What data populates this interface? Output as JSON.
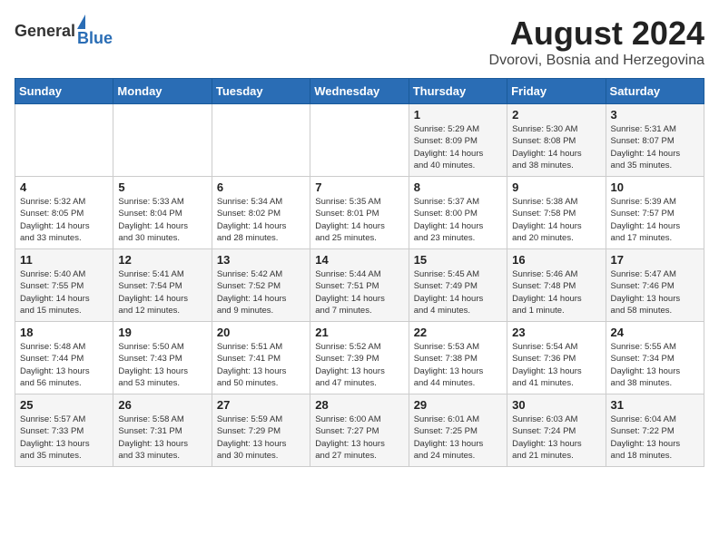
{
  "header": {
    "logo_general": "General",
    "logo_blue": "Blue",
    "month_year": "August 2024",
    "location": "Dvorovi, Bosnia and Herzegovina"
  },
  "weekdays": [
    "Sunday",
    "Monday",
    "Tuesday",
    "Wednesday",
    "Thursday",
    "Friday",
    "Saturday"
  ],
  "weeks": [
    [
      {
        "day": "",
        "info": ""
      },
      {
        "day": "",
        "info": ""
      },
      {
        "day": "",
        "info": ""
      },
      {
        "day": "",
        "info": ""
      },
      {
        "day": "1",
        "info": "Sunrise: 5:29 AM\nSunset: 8:09 PM\nDaylight: 14 hours\nand 40 minutes."
      },
      {
        "day": "2",
        "info": "Sunrise: 5:30 AM\nSunset: 8:08 PM\nDaylight: 14 hours\nand 38 minutes."
      },
      {
        "day": "3",
        "info": "Sunrise: 5:31 AM\nSunset: 8:07 PM\nDaylight: 14 hours\nand 35 minutes."
      }
    ],
    [
      {
        "day": "4",
        "info": "Sunrise: 5:32 AM\nSunset: 8:05 PM\nDaylight: 14 hours\nand 33 minutes."
      },
      {
        "day": "5",
        "info": "Sunrise: 5:33 AM\nSunset: 8:04 PM\nDaylight: 14 hours\nand 30 minutes."
      },
      {
        "day": "6",
        "info": "Sunrise: 5:34 AM\nSunset: 8:02 PM\nDaylight: 14 hours\nand 28 minutes."
      },
      {
        "day": "7",
        "info": "Sunrise: 5:35 AM\nSunset: 8:01 PM\nDaylight: 14 hours\nand 25 minutes."
      },
      {
        "day": "8",
        "info": "Sunrise: 5:37 AM\nSunset: 8:00 PM\nDaylight: 14 hours\nand 23 minutes."
      },
      {
        "day": "9",
        "info": "Sunrise: 5:38 AM\nSunset: 7:58 PM\nDaylight: 14 hours\nand 20 minutes."
      },
      {
        "day": "10",
        "info": "Sunrise: 5:39 AM\nSunset: 7:57 PM\nDaylight: 14 hours\nand 17 minutes."
      }
    ],
    [
      {
        "day": "11",
        "info": "Sunrise: 5:40 AM\nSunset: 7:55 PM\nDaylight: 14 hours\nand 15 minutes."
      },
      {
        "day": "12",
        "info": "Sunrise: 5:41 AM\nSunset: 7:54 PM\nDaylight: 14 hours\nand 12 minutes."
      },
      {
        "day": "13",
        "info": "Sunrise: 5:42 AM\nSunset: 7:52 PM\nDaylight: 14 hours\nand 9 minutes."
      },
      {
        "day": "14",
        "info": "Sunrise: 5:44 AM\nSunset: 7:51 PM\nDaylight: 14 hours\nand 7 minutes."
      },
      {
        "day": "15",
        "info": "Sunrise: 5:45 AM\nSunset: 7:49 PM\nDaylight: 14 hours\nand 4 minutes."
      },
      {
        "day": "16",
        "info": "Sunrise: 5:46 AM\nSunset: 7:48 PM\nDaylight: 14 hours\nand 1 minute."
      },
      {
        "day": "17",
        "info": "Sunrise: 5:47 AM\nSunset: 7:46 PM\nDaylight: 13 hours\nand 58 minutes."
      }
    ],
    [
      {
        "day": "18",
        "info": "Sunrise: 5:48 AM\nSunset: 7:44 PM\nDaylight: 13 hours\nand 56 minutes."
      },
      {
        "day": "19",
        "info": "Sunrise: 5:50 AM\nSunset: 7:43 PM\nDaylight: 13 hours\nand 53 minutes."
      },
      {
        "day": "20",
        "info": "Sunrise: 5:51 AM\nSunset: 7:41 PM\nDaylight: 13 hours\nand 50 minutes."
      },
      {
        "day": "21",
        "info": "Sunrise: 5:52 AM\nSunset: 7:39 PM\nDaylight: 13 hours\nand 47 minutes."
      },
      {
        "day": "22",
        "info": "Sunrise: 5:53 AM\nSunset: 7:38 PM\nDaylight: 13 hours\nand 44 minutes."
      },
      {
        "day": "23",
        "info": "Sunrise: 5:54 AM\nSunset: 7:36 PM\nDaylight: 13 hours\nand 41 minutes."
      },
      {
        "day": "24",
        "info": "Sunrise: 5:55 AM\nSunset: 7:34 PM\nDaylight: 13 hours\nand 38 minutes."
      }
    ],
    [
      {
        "day": "25",
        "info": "Sunrise: 5:57 AM\nSunset: 7:33 PM\nDaylight: 13 hours\nand 35 minutes."
      },
      {
        "day": "26",
        "info": "Sunrise: 5:58 AM\nSunset: 7:31 PM\nDaylight: 13 hours\nand 33 minutes."
      },
      {
        "day": "27",
        "info": "Sunrise: 5:59 AM\nSunset: 7:29 PM\nDaylight: 13 hours\nand 30 minutes."
      },
      {
        "day": "28",
        "info": "Sunrise: 6:00 AM\nSunset: 7:27 PM\nDaylight: 13 hours\nand 27 minutes."
      },
      {
        "day": "29",
        "info": "Sunrise: 6:01 AM\nSunset: 7:25 PM\nDaylight: 13 hours\nand 24 minutes."
      },
      {
        "day": "30",
        "info": "Sunrise: 6:03 AM\nSunset: 7:24 PM\nDaylight: 13 hours\nand 21 minutes."
      },
      {
        "day": "31",
        "info": "Sunrise: 6:04 AM\nSunset: 7:22 PM\nDaylight: 13 hours\nand 18 minutes."
      }
    ]
  ]
}
